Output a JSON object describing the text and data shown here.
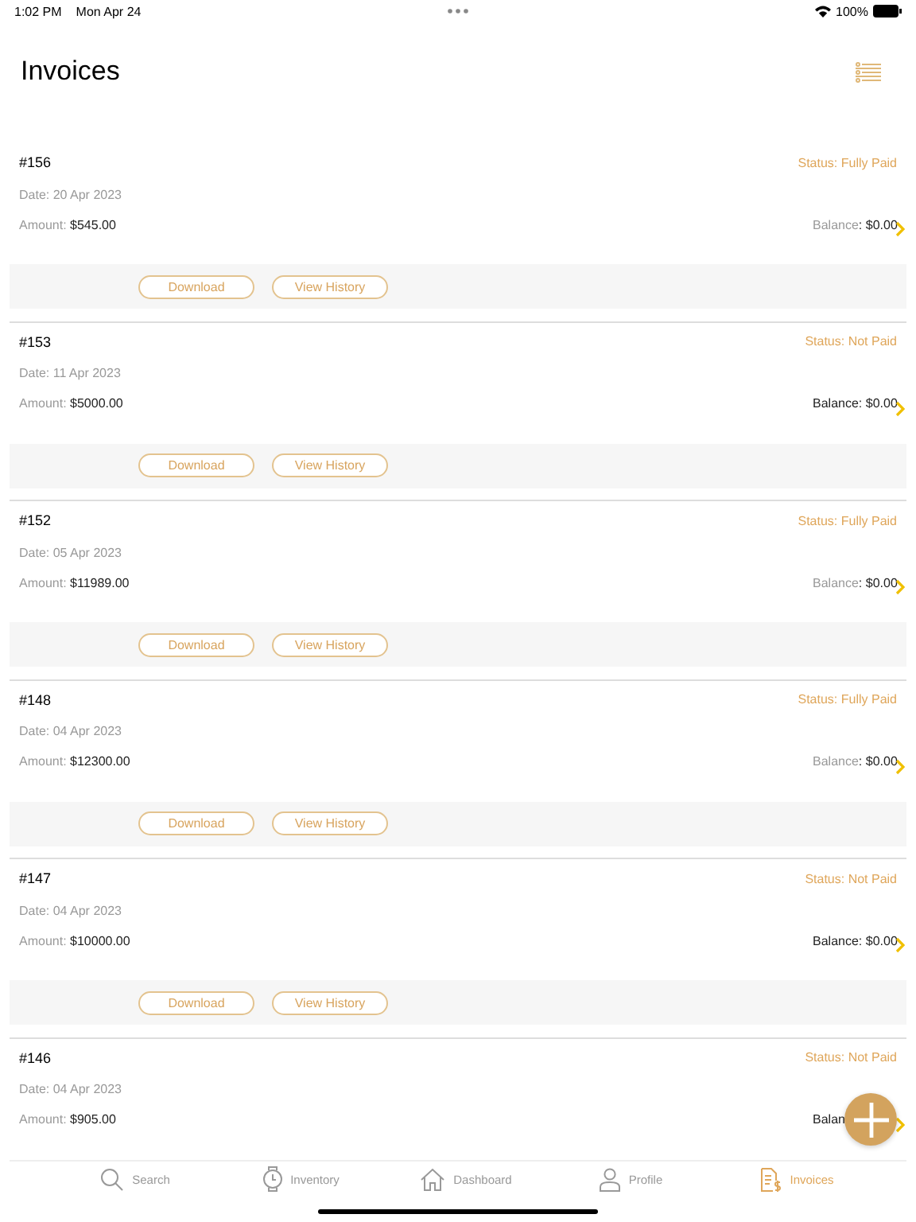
{
  "status_bar": {
    "time": "1:02 PM",
    "date": "Mon Apr 24",
    "battery": "100%"
  },
  "header": {
    "title": "Invoices"
  },
  "invoices": [
    {
      "number": "#156",
      "status": "Status: Fully Paid",
      "date": "Date: 20 Apr 2023",
      "amount_label": "Amount: ",
      "amount": "$545.00",
      "balance_label": "Balance",
      "balance": ": $0.00",
      "paid": true,
      "actions": [
        "Download",
        "View History"
      ]
    },
    {
      "number": "#153",
      "status": "Status: Not Paid",
      "date": "Date: 11 Apr 2023",
      "amount_label": "Amount: ",
      "amount": "$5000.00",
      "balance_label": "Balance",
      "balance": ": $0.00",
      "paid": false,
      "actions": [
        "Download",
        "View History"
      ]
    },
    {
      "number": "#152",
      "status": "Status: Fully Paid",
      "date": "Date: 05 Apr 2023",
      "amount_label": "Amount: ",
      "amount": "$11989.00",
      "balance_label": "Balance",
      "balance": ": $0.00",
      "paid": true,
      "actions": [
        "Download",
        "View History"
      ]
    },
    {
      "number": "#148",
      "status": "Status: Fully Paid",
      "date": "Date: 04 Apr 2023",
      "amount_label": "Amount: ",
      "amount": "$12300.00",
      "balance_label": "Balance",
      "balance": ": $0.00",
      "paid": true,
      "actions": [
        "Download",
        "View History"
      ]
    },
    {
      "number": "#147",
      "status": "Status: Not Paid",
      "date": "Date: 04 Apr 2023",
      "amount_label": "Amount: ",
      "amount": "$10000.00",
      "balance_label": "Balance",
      "balance": ": $0.00",
      "paid": false,
      "actions": [
        "Download",
        "View History"
      ]
    },
    {
      "number": "#146",
      "status": "Status: Not Paid",
      "date": "Date: 04 Apr 2023",
      "amount_label": "Amount: ",
      "amount": "$905.00",
      "balance_label": "Balan",
      "paid": false
    }
  ],
  "tabs": [
    {
      "kind": "search",
      "label": "Search",
      "selected": false
    },
    {
      "kind": "inventory",
      "label": "Inventory",
      "selected": false
    },
    {
      "kind": "dashboard",
      "label": "Dashboard",
      "selected": false
    },
    {
      "kind": "profile",
      "label": "Profile",
      "selected": false
    },
    {
      "kind": "invoices",
      "label": "Invoices",
      "selected": true
    }
  ]
}
